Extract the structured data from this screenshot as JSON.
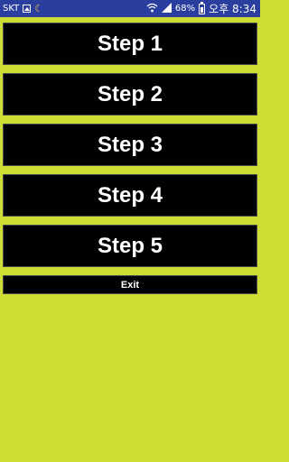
{
  "status_bar": {
    "carrier": "SKT",
    "battery_percent": "68%",
    "time": "오후 8:34",
    "icons": [
      "image-icon",
      "moon-icon",
      "wifi-icon",
      "signal-icon",
      "battery-icon"
    ],
    "colors": {
      "background": "#2a3ea0",
      "moon": "#f3c23a"
    }
  },
  "menu": {
    "steps": [
      "Step 1",
      "Step 2",
      "Step 3",
      "Step 4",
      "Step 5"
    ],
    "exit_label": "Exit"
  },
  "colors": {
    "page_background": "#cddd33",
    "button_background": "#000000",
    "button_text": "#ffffff"
  }
}
